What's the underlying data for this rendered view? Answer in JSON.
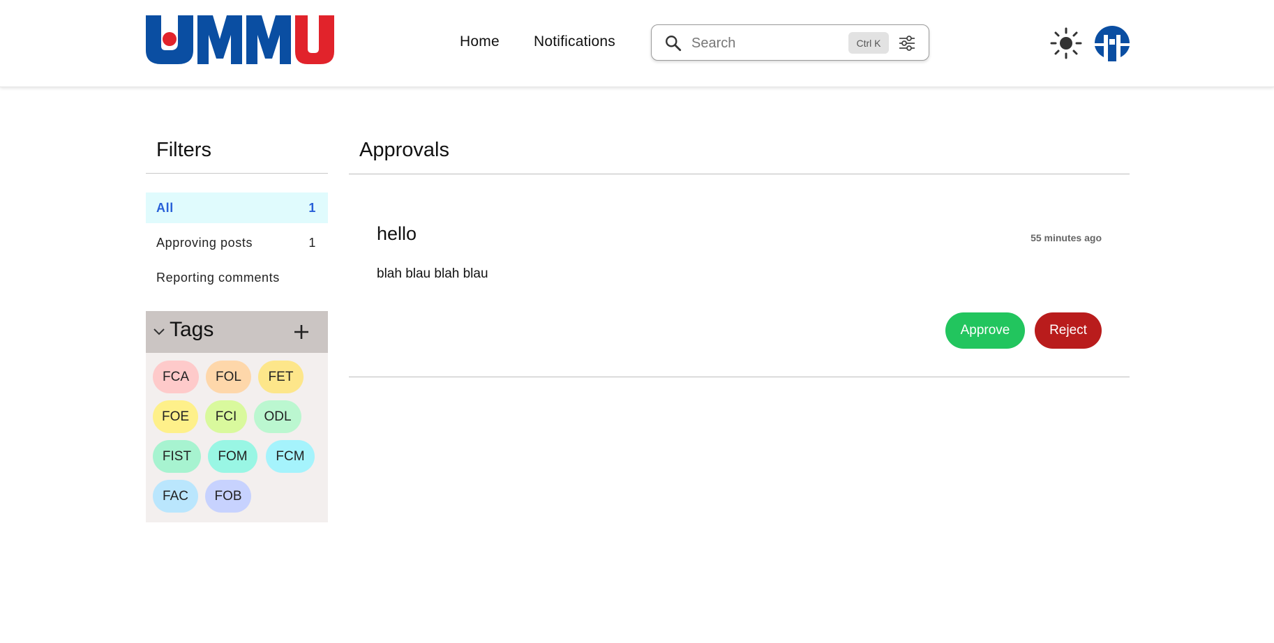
{
  "header": {
    "logo_text": "UMMU",
    "nav": {
      "home": "Home",
      "notifications": "Notifications"
    },
    "search": {
      "placeholder": "Search",
      "shortcut": "Ctrl K"
    },
    "icons": [
      "search-icon",
      "filter-settings-icon",
      "sun-icon",
      "avatar"
    ],
    "colors": {
      "logo_blue": "#0a4ea2",
      "logo_red": "#e1232b"
    }
  },
  "sidebar": {
    "title": "Filters",
    "filters": [
      {
        "label": "All",
        "count": "1",
        "active": true
      },
      {
        "label": "Approving posts",
        "count": "1",
        "active": false
      },
      {
        "label": "Reporting comments",
        "count": "",
        "active": false
      }
    ],
    "tags_title": "Tags",
    "tags": [
      {
        "label": "FCA",
        "color": "#fecaca"
      },
      {
        "label": "FOL",
        "color": "#fed7aa"
      },
      {
        "label": "FET",
        "color": "#fde68a"
      },
      {
        "label": "FOE",
        "color": "#fef08a"
      },
      {
        "label": "FCI",
        "color": "#d9f99d"
      },
      {
        "label": "ODL",
        "color": "#bbf7d0"
      },
      {
        "label": "FIST",
        "color": "#a7f3d0"
      },
      {
        "label": "FOM",
        "color": "#99f6e4"
      },
      {
        "label": "FCM",
        "color": "#a5f3fc"
      },
      {
        "label": "FAC",
        "color": "#bae6fd"
      },
      {
        "label": "FOB",
        "color": "#c7d2fe"
      }
    ]
  },
  "main": {
    "title": "Approvals",
    "post": {
      "title": "hello",
      "time": "55 minutes ago",
      "body": "blah blau blah blau"
    },
    "actions": {
      "approve": "Approve",
      "reject": "Reject",
      "approve_color": "#22c55e",
      "reject_color": "#b91c1c"
    }
  }
}
